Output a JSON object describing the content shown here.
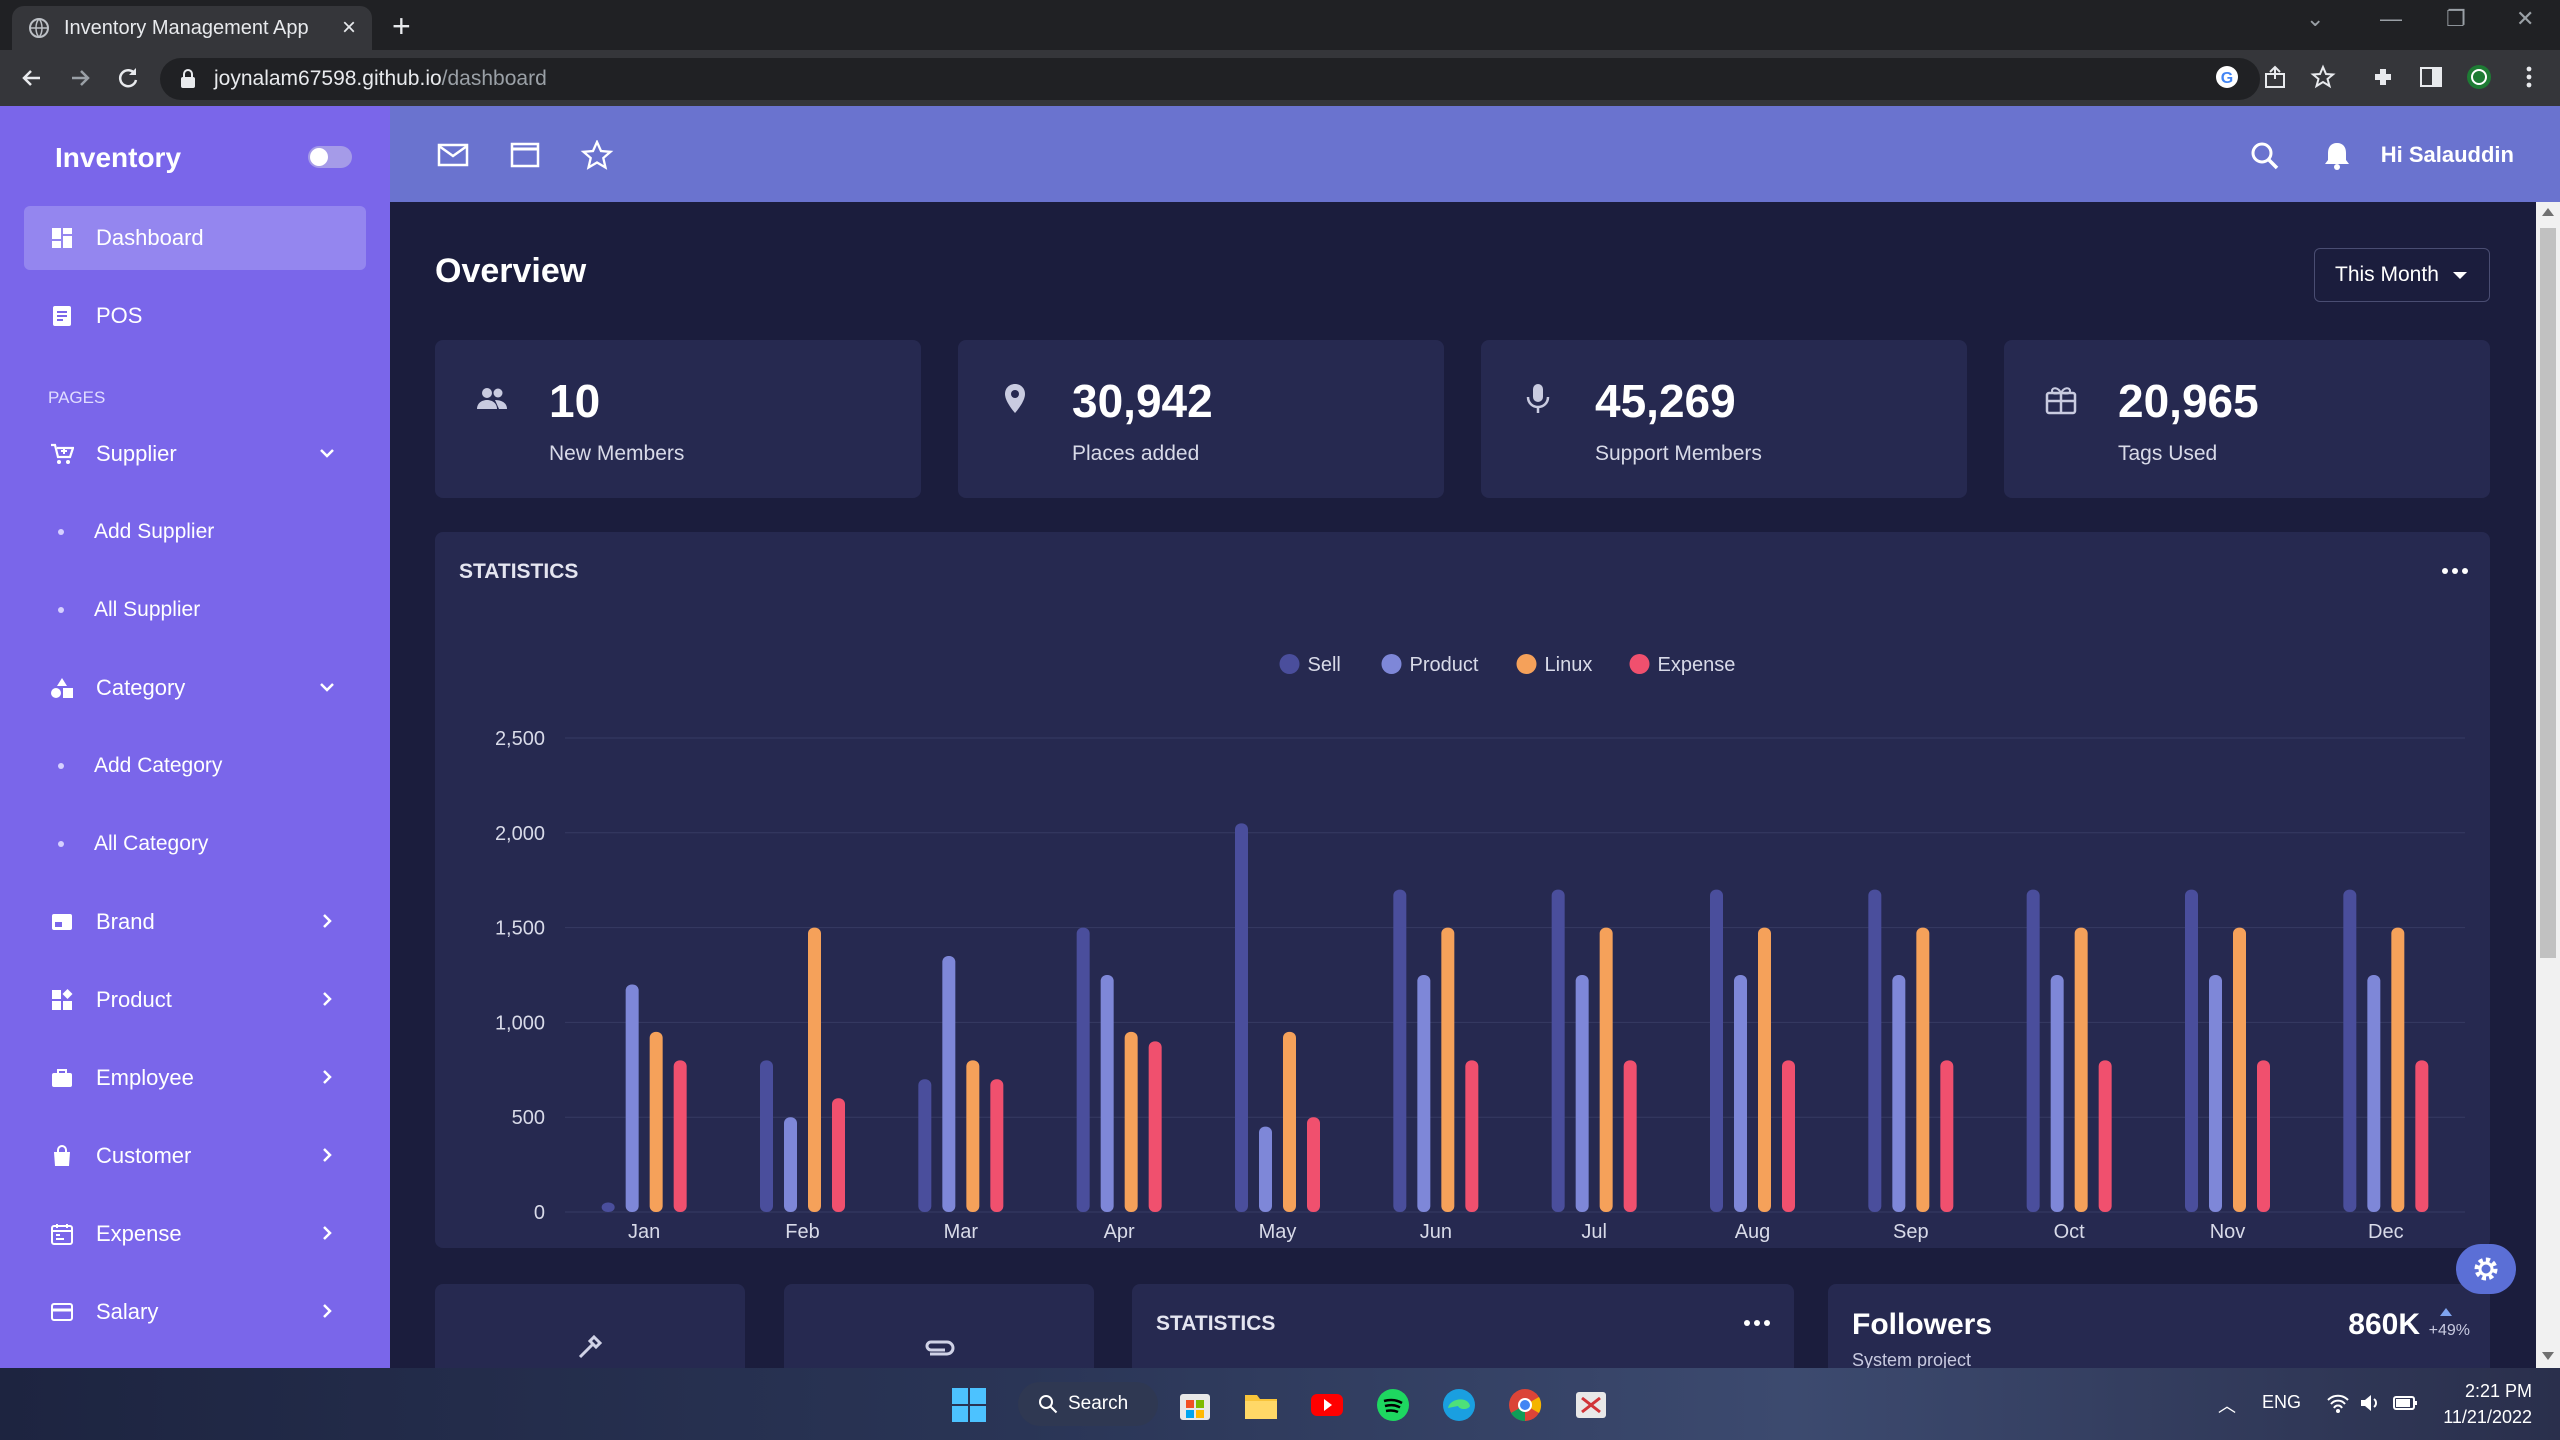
{
  "browser": {
    "tab_title": "Inventory Management App",
    "url_host": "joynalam67598.github.io",
    "url_path": "/dashboard"
  },
  "sidebar": {
    "brand": "Inventory",
    "section_pages": "PAGES",
    "items": [
      {
        "label": "Dashboard",
        "icon": "dashboard-icon",
        "active": true
      },
      {
        "label": "POS",
        "icon": "pos-icon"
      },
      {
        "label": "Supplier",
        "icon": "cart-icon",
        "expanded": true
      },
      {
        "label": "Add Supplier",
        "sub": true
      },
      {
        "label": "All Supplier",
        "sub": true
      },
      {
        "label": "Category",
        "icon": "shapes-icon",
        "expanded": true
      },
      {
        "label": "Add Category",
        "sub": true
      },
      {
        "label": "All Category",
        "sub": true
      },
      {
        "label": "Brand",
        "icon": "brand-icon"
      },
      {
        "label": "Product",
        "icon": "product-icon"
      },
      {
        "label": "Employee",
        "icon": "briefcase-icon"
      },
      {
        "label": "Customer",
        "icon": "bag-icon"
      },
      {
        "label": "Expense",
        "icon": "calendar-icon"
      },
      {
        "label": "Salary",
        "icon": "card-icon"
      }
    ]
  },
  "header": {
    "greeting": "Hi Salauddin"
  },
  "main": {
    "title": "Overview",
    "period": "This Month",
    "stats": [
      {
        "value": "10",
        "label": "New Members",
        "icon": "people-icon"
      },
      {
        "value": "30,942",
        "label": "Places added",
        "icon": "location-icon"
      },
      {
        "value": "45,269",
        "label": "Support Members",
        "icon": "mic-icon"
      },
      {
        "value": "20,965",
        "label": "Tags Used",
        "icon": "gift-icon"
      }
    ],
    "chart_title": "STATISTICS",
    "bottom": {
      "stats_title": "STATISTICS",
      "followers_title": "Followers",
      "followers_sub": "System project",
      "followers_value": "860K",
      "followers_change": "+49%"
    }
  },
  "chart_data": {
    "type": "bar",
    "categories": [
      "Jan",
      "Feb",
      "Mar",
      "Apr",
      "May",
      "Jun",
      "Jul",
      "Aug",
      "Sep",
      "Oct",
      "Nov",
      "Dec"
    ],
    "series": [
      {
        "name": "Sell",
        "color": "#4a4e9c",
        "values": [
          50,
          800,
          700,
          1500,
          2050,
          1700,
          1700,
          1700,
          1700,
          1700,
          1700,
          1700
        ]
      },
      {
        "name": "Product",
        "color": "#7e87d8",
        "values": [
          1200,
          500,
          1350,
          1250,
          450,
          1250,
          1250,
          1250,
          1250,
          1250,
          1250,
          1250
        ]
      },
      {
        "name": "Linux",
        "color": "#f5a15a",
        "values": [
          950,
          1500,
          800,
          950,
          950,
          1500,
          1500,
          1500,
          1500,
          1500,
          1500,
          1500
        ]
      },
      {
        "name": "Expense",
        "color": "#f0506e",
        "values": [
          800,
          600,
          700,
          900,
          500,
          800,
          800,
          800,
          800,
          800,
          800,
          800
        ]
      }
    ],
    "yticks": [
      "0",
      "500",
      "1,000",
      "1,500",
      "2,000",
      "2,500"
    ],
    "ylim": [
      0,
      2500
    ],
    "grid": true,
    "legend": "top-center"
  },
  "taskbar": {
    "search_label": "Search",
    "lang": "ENG",
    "time": "2:21 PM",
    "date": "11/21/2022"
  }
}
